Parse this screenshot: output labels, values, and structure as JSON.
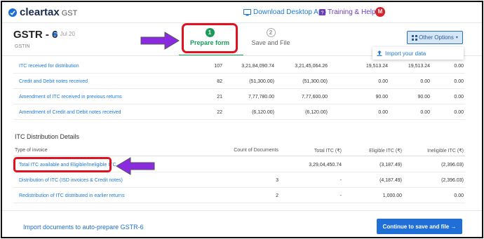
{
  "nav": {
    "brand": "cleartax",
    "brand_suffix": "GST",
    "download_label": "Download Desktop App",
    "training_label": "Training & Help",
    "avatar_initial": "M"
  },
  "header": {
    "title": "GSTR - 6",
    "period": "Jul 20",
    "gstin_label": "GSTIN"
  },
  "steps": [
    {
      "number": "1",
      "label": "Prepare form",
      "active": true
    },
    {
      "number": "2",
      "label": "Save and File",
      "active": false
    }
  ],
  "other_options": {
    "label": "Other Options",
    "menu": [
      {
        "label": "Import your data"
      }
    ]
  },
  "itc_received_rows": [
    {
      "name": "ITC received for distribution",
      "count": "107",
      "v1": "3,21,84,090.74",
      "v2": "3,21,45,064.26",
      "v3": "19,513.24",
      "v4": "19,513.24",
      "v5": "0.00"
    },
    {
      "name": "Credit and Debit notes received",
      "count": "82",
      "v1": "(51,300.00)",
      "v2": "(51,300.00)",
      "v3": "0.00",
      "v4": "0.00",
      "v5": "0.00"
    },
    {
      "name": "Amendment of ITC received in previous returns",
      "count": "21",
      "v1": "7,77,780.00",
      "v2": "7,77,600.00",
      "v3": "90.00",
      "v4": "90.00",
      "v5": "0.00"
    },
    {
      "name": "Amendment of Credit and Debit notes received",
      "count": "22",
      "v1": "(6,120.00)",
      "v2": "(6,120.00)",
      "v3": "0.00",
      "v4": "0.00",
      "v5": "0.00"
    }
  ],
  "distribution": {
    "title": "ITC Distribution Details",
    "columns": [
      "Type of invoice",
      "Count of Documents",
      "Total ITC (₹)",
      "Eligible ITC (₹)",
      "Ineligible ITC (₹)"
    ],
    "rows": [
      {
        "name": "Total ITC available and Eligible/Ineligible ITC",
        "count": "",
        "total": "3,29,04,450.74",
        "eligible": "(3,187.49)",
        "ineligible": "(2,396.03)"
      },
      {
        "name": "Distribution of ITC (ISD invoices & Credit notes)",
        "count": "3",
        "total": "-",
        "eligible": "(4,187.49)",
        "ineligible": "(2,396.03)"
      },
      {
        "name": "Redistribution of ITC distributed in earlier returns",
        "count": "2",
        "total": "-",
        "eligible": "1,000.00",
        "ineligible": "0.00"
      }
    ]
  },
  "footer": {
    "import_label": "Import documents to auto-prepare GSTR-6",
    "continue_label": "Continue to save and file →"
  },
  "colors": {
    "accent_blue": "#1f6fd6",
    "step_green": "#1a9b5a",
    "annotation_red": "#e0121f",
    "annotation_purple": "#8a2be2"
  }
}
